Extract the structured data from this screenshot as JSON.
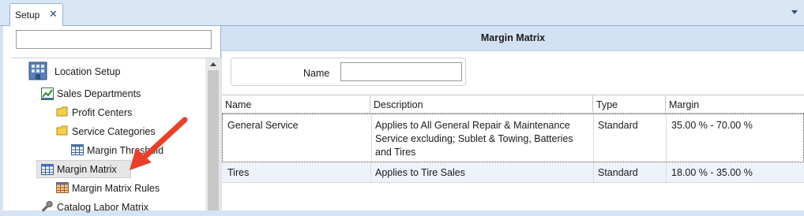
{
  "tabs": [
    {
      "label": "Setup",
      "close": "✕"
    }
  ],
  "left_panel": {
    "search_value": "",
    "tree": [
      {
        "label": "Location Setup",
        "icon": "building-icon"
      },
      {
        "label": "Sales Departments",
        "icon": "chart-icon"
      },
      {
        "label": "Profit Centers",
        "icon": "folder-icon"
      },
      {
        "label": "Service Categories",
        "icon": "folder-icon"
      },
      {
        "label": "Margin Threshold",
        "icon": "grid-icon"
      },
      {
        "label": "Margin Matrix",
        "icon": "grid-icon",
        "selected": true
      },
      {
        "label": "Margin Matrix Rules",
        "icon": "grid-orange-icon"
      },
      {
        "label": "Catalog Labor Matrix",
        "icon": "wrench-icon"
      }
    ]
  },
  "right_panel": {
    "title": "Margin Matrix",
    "filter": {
      "name_label": "Name",
      "name_value": ""
    },
    "grid": {
      "columns": [
        "Name",
        "Description",
        "Type",
        "Margin"
      ],
      "rows": [
        {
          "name": "General Service",
          "description": "Applies to All General Repair & Maintenance Service excluding; Sublet & Towing, Batteries and Tires",
          "type": "Standard",
          "margin": "35.00 % - 70.00 %"
        },
        {
          "name": "Tires",
          "description": "Applies to Tire Sales",
          "type": "Standard",
          "margin": "18.00 % - 35.00 %"
        }
      ]
    }
  },
  "colors": {
    "accent": "#d2e1f3",
    "arrow": "#e8402a"
  }
}
